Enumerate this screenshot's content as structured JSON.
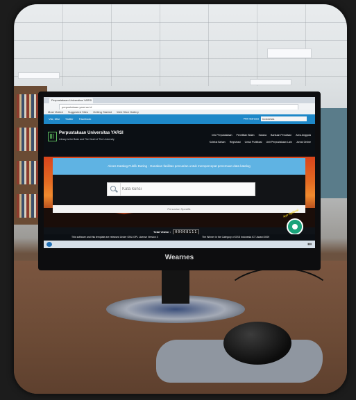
{
  "browser": {
    "tab_title": "Perpustakaan Universitas YARSI",
    "url": "perpustakaan.yarsi.ac.id",
    "bookmarks": [
      "Most Visited",
      "Suggested Sites",
      "Getting Started",
      "Web Slice Gallery"
    ]
  },
  "topnav": {
    "links": [
      "Visi, Misi",
      "Twitter",
      "Facebook"
    ],
    "language_label": "Pilih Bahasa",
    "language_value": "Indonesia"
  },
  "header": {
    "title": "Perpustakaan Universitas YARSI",
    "tagline": "Library is the Brain and The Heart of The University",
    "menu_row1": [
      "Info Perpustakaan",
      "Penelitian Bidan",
      "Sarana",
      "Bantuan Penulisan",
      "Area Anggota"
    ],
    "menu_row2": [
      "Koleksi Bahan",
      "Registrasi",
      "Untuk Publikasi",
      "Unit Perpustakaan Lain",
      "Jurnal Online"
    ]
  },
  "hero": {
    "banner": "Akses Katalog Publik Daring - Gunakan fasilitas pencarian untuk mempercepat penemuan data katalog",
    "search_placeholder": "Kata kunci",
    "advanced_search": "Pencarian Spesifik"
  },
  "visitor": {
    "label": "Total Visitor :",
    "count": "00008111"
  },
  "footer": {
    "left": "This software and this template are released Under GNU GPL License Version 3",
    "right": "The Winner in the Category of OSS Indonesia ICT Award 2009"
  },
  "chat": {
    "label": "Ayo Ngobrol"
  },
  "monitor": {
    "brand": "Wearnes"
  }
}
